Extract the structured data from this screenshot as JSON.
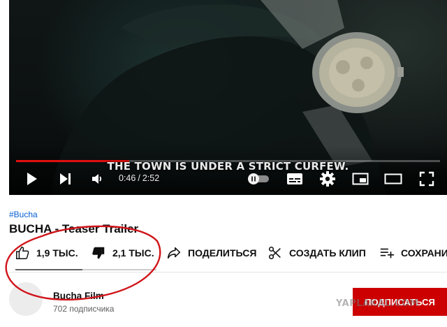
{
  "player": {
    "subtitle": "THE TOWN IS UNDER A STRICT CURFEW.",
    "current_time": "0:46",
    "separator": "/",
    "duration": "2:52",
    "progress_fraction": 0.267,
    "progress_color": "#e20f0f",
    "icons": {
      "play": "play-icon",
      "next": "next-icon",
      "volume": "volume-icon",
      "autoplay": "autoplay-toggle-icon",
      "subtitles": "subtitles-icon",
      "settings": "gear-icon",
      "miniplayer": "miniplayer-icon",
      "theater": "theater-mode-icon",
      "fullscreen": "fullscreen-icon"
    }
  },
  "video": {
    "hashtag": "#Bucha",
    "title": "BUCHA - Teaser Trailer"
  },
  "actions": {
    "like_count": "1,9 ТЫС.",
    "dislike_count": "2,1 ТЫС.",
    "share_label": "ПОДЕЛИТЬСЯ",
    "clip_label": "СОЗДАТЬ КЛИП",
    "save_label": "СОХРАНИ",
    "like_ratio": 0.475,
    "icons": {
      "like": "thumbs-up-icon",
      "dislike": "thumbs-down-icon",
      "share": "share-arrow-icon",
      "clip": "scissors-icon",
      "save": "add-to-playlist-icon"
    }
  },
  "channel": {
    "name": "Bucha Film",
    "subscribers": "702 подписчика",
    "subscribe_label": "ПОДПИСАТЬСЯ",
    "subscribe_color": "#cc0000"
  },
  "watermark": "YAPLAKAL.COM",
  "annotation": {
    "color": "#d0141a",
    "shape": "ellipse"
  }
}
